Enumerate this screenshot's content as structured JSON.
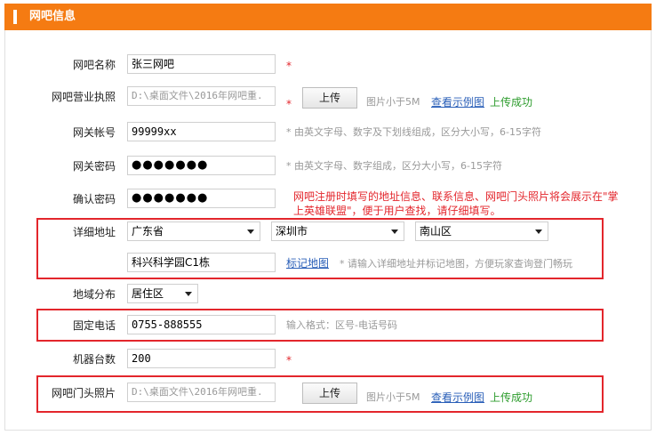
{
  "header": {
    "title": "网吧信息"
  },
  "form": {
    "name": {
      "label": "网吧名称",
      "value": "张三网吧",
      "required": "*"
    },
    "license": {
      "label": "网吧营业执照",
      "value": "D:\\桌面文件\\2016年网吧重.",
      "required": "*",
      "upload_label": "上传",
      "size_hint": "图片小于5M",
      "sample_link": "查看示例图",
      "status": "上传成功"
    },
    "gateway_account": {
      "label": "网关帐号",
      "value": "99999xx",
      "hint": "* 由英文字母、数字及下划线组成，区分大小写，6-15字符"
    },
    "gateway_password": {
      "label": "网关密码",
      "value": "●●●●●●●",
      "hint": "* 由英文字母、数字组成，区分大小写，6-15字符"
    },
    "confirm_password": {
      "label": "确认密码",
      "value": "●●●●●●●",
      "notice_line1": "网吧注册时填写的地址信息、联系信息、网吧门头照片将会展示在\"掌",
      "notice_line2": "上英雄联盟\"，便于用户查找，请仔细填写。"
    },
    "address": {
      "label": "详细地址",
      "province": "广东省",
      "city": "深圳市",
      "district": "南山区",
      "street": "科兴科学园C1栋",
      "map_link": "标记地图",
      "hint": "* 请输入详细地址并标记地图，方便玩家查询登门畅玩"
    },
    "area": {
      "label": "地域分布",
      "value": "居住区"
    },
    "phone": {
      "label": "固定电话",
      "value": "0755-888555",
      "hint": "输入格式：区号-电话号码"
    },
    "machines": {
      "label": "机器台数",
      "value": "200",
      "required": "*"
    },
    "photo": {
      "label": "网吧门头照片",
      "value": "D:\\桌面文件\\2016年网吧重.",
      "upload_label": "上传",
      "size_hint": "图片小于5M",
      "sample_link": "查看示例图",
      "status": "上传成功"
    }
  },
  "colors": {
    "header": "#f57b12",
    "required": "#e3262c",
    "link": "#2a5fb8",
    "success": "#2d9c2d",
    "highlight_box": "#e3262c"
  }
}
